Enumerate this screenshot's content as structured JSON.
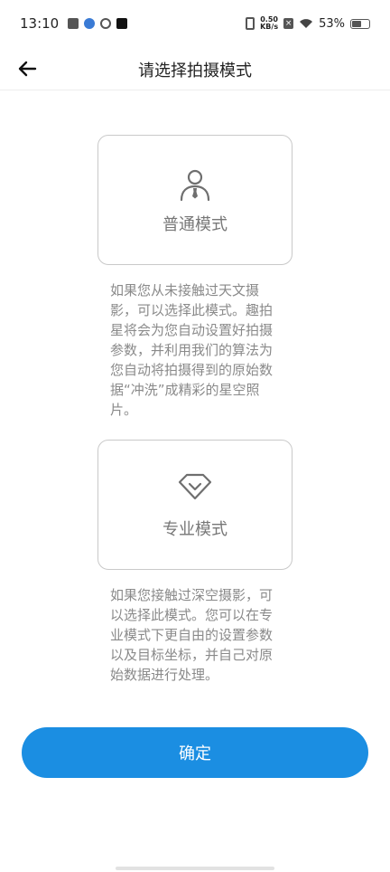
{
  "status_bar": {
    "time": "13:10",
    "net_speed_value": "0.50",
    "net_speed_unit": "KB/s",
    "battery": "53%"
  },
  "header": {
    "title": "请选择拍摄模式"
  },
  "modes": [
    {
      "label": "普通模式",
      "icon": "person-icon",
      "description": "如果您从未接触过天文摄影，可以选择此模式。趣拍星将会为您自动设置好拍摄参数，并利用我们的算法为您自动将拍摄得到的原始数据“冲洗”成精彩的星空照片。"
    },
    {
      "label": "专业模式",
      "icon": "diamond-icon",
      "description": "如果您接触过深空摄影，可以选择此模式。您可以在专业模式下更自由的设置参数以及目标坐标，并自己对原始数据进行处理。"
    }
  ],
  "footer": {
    "confirm_label": "确定"
  },
  "colors": {
    "primary": "#1b8ee2",
    "card_border": "#c9c9c9",
    "description_text": "#8a8a8a"
  }
}
